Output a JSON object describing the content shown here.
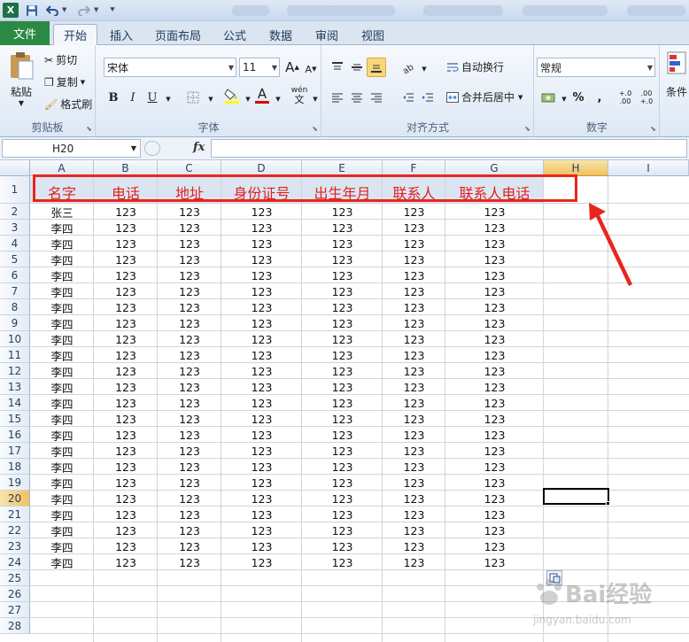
{
  "quick_access": {
    "excel_icon": "X",
    "save_icon": "save-icon",
    "undo_icon": "undo-icon",
    "redo_icon": "redo-icon"
  },
  "tabs": [
    "文件",
    "开始",
    "插入",
    "页面布局",
    "公式",
    "数据",
    "审阅",
    "视图"
  ],
  "clipboard": {
    "paste": "粘贴",
    "cut": "剪切",
    "copy": "复制",
    "format_painter": "格式刷",
    "label": "剪贴板"
  },
  "font": {
    "name": "宋体",
    "size": "11",
    "grow": "A",
    "shrink": "A",
    "bold": "B",
    "italic": "I",
    "underline": "U",
    "font_color_glyph": "A",
    "phonetic": "wén",
    "label": "字体"
  },
  "alignment": {
    "wrap_text": "自动换行",
    "merge_center": "合并后居中",
    "label": "对齐方式"
  },
  "number": {
    "format": "常规",
    "percent": "%",
    "comma": ",",
    "inc_decimal": "+.0 .00",
    "dec_decimal": ".00 +.0",
    "label": "数字"
  },
  "styles": {
    "conditional": "条件"
  },
  "formula_bar": {
    "name_box": "H20",
    "fx": "fx",
    "value": ""
  },
  "columns": [
    "A",
    "B",
    "C",
    "D",
    "E",
    "F",
    "G",
    "H",
    "I"
  ],
  "selected_column": "H",
  "selected_row": "20",
  "header_row": [
    "名字",
    "电话",
    "地址",
    "身份证号",
    "出生年月",
    "联系人",
    "联系人电话"
  ],
  "data_rows": [
    [
      "张三",
      "123",
      "123",
      "123",
      "123",
      "123",
      "123"
    ],
    [
      "李四",
      "123",
      "123",
      "123",
      "123",
      "123",
      "123"
    ],
    [
      "李四",
      "123",
      "123",
      "123",
      "123",
      "123",
      "123"
    ],
    [
      "李四",
      "123",
      "123",
      "123",
      "123",
      "123",
      "123"
    ],
    [
      "李四",
      "123",
      "123",
      "123",
      "123",
      "123",
      "123"
    ],
    [
      "李四",
      "123",
      "123",
      "123",
      "123",
      "123",
      "123"
    ],
    [
      "李四",
      "123",
      "123",
      "123",
      "123",
      "123",
      "123"
    ],
    [
      "李四",
      "123",
      "123",
      "123",
      "123",
      "123",
      "123"
    ],
    [
      "李四",
      "123",
      "123",
      "123",
      "123",
      "123",
      "123"
    ],
    [
      "李四",
      "123",
      "123",
      "123",
      "123",
      "123",
      "123"
    ],
    [
      "李四",
      "123",
      "123",
      "123",
      "123",
      "123",
      "123"
    ],
    [
      "李四",
      "123",
      "123",
      "123",
      "123",
      "123",
      "123"
    ],
    [
      "李四",
      "123",
      "123",
      "123",
      "123",
      "123",
      "123"
    ],
    [
      "李四",
      "123",
      "123",
      "123",
      "123",
      "123",
      "123"
    ],
    [
      "李四",
      "123",
      "123",
      "123",
      "123",
      "123",
      "123"
    ],
    [
      "李四",
      "123",
      "123",
      "123",
      "123",
      "123",
      "123"
    ],
    [
      "李四",
      "123",
      "123",
      "123",
      "123",
      "123",
      "123"
    ],
    [
      "李四",
      "123",
      "123",
      "123",
      "123",
      "123",
      "123"
    ],
    [
      "李四",
      "123",
      "123",
      "123",
      "123",
      "123",
      "123"
    ],
    [
      "李四",
      "123",
      "123",
      "123",
      "123",
      "123",
      "123"
    ],
    [
      "李四",
      "123",
      "123",
      "123",
      "123",
      "123",
      "123"
    ],
    [
      "李四",
      "123",
      "123",
      "123",
      "123",
      "123",
      "123"
    ],
    [
      "李四",
      "123",
      "123",
      "123",
      "123",
      "123",
      "123"
    ]
  ],
  "row_numbers": [
    "1",
    "2",
    "3",
    "4",
    "5",
    "6",
    "7",
    "8",
    "9",
    "10",
    "11",
    "12",
    "13",
    "14",
    "15",
    "16",
    "17",
    "18",
    "19",
    "20",
    "21",
    "22",
    "23",
    "24",
    "25",
    "26",
    "27",
    "28"
  ],
  "colors": {
    "header_text": "#e0201e",
    "highlight_box": "#e8251f",
    "arrow": "#e8251f",
    "file_tab": "#2a8a43",
    "header_fill": "#dbe5f1"
  },
  "watermark": {
    "text": "Bai经验",
    "sub": "jingyan.baidu.com"
  }
}
